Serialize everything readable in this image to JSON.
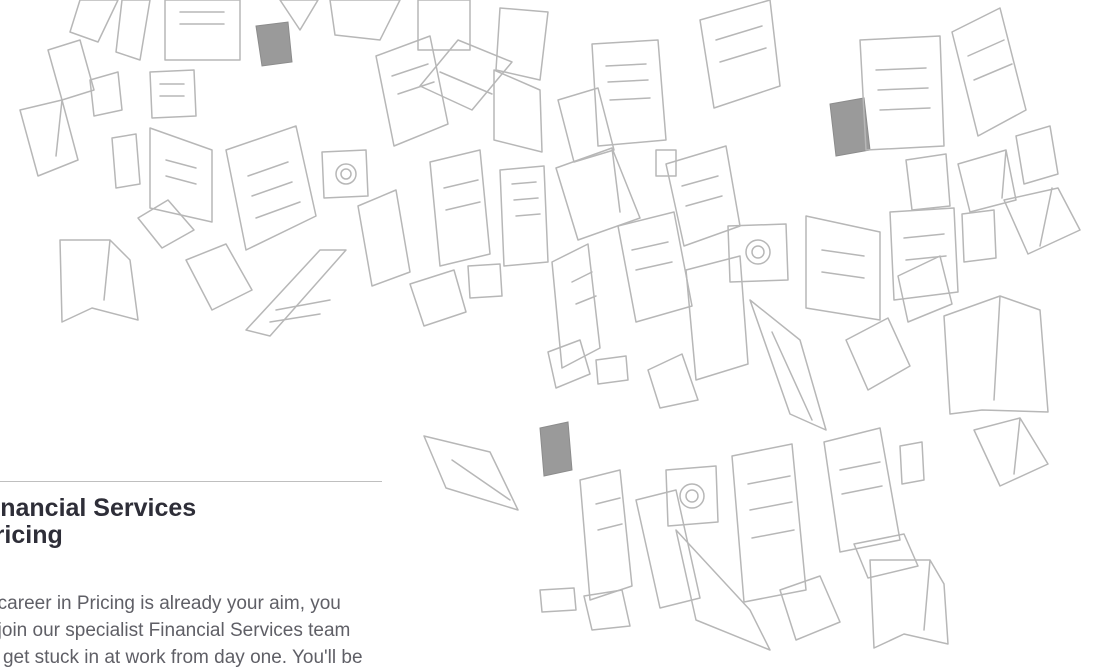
{
  "illustration": {
    "name": "hand-drawn-books-cluster"
  },
  "section": {
    "heading_lines": [
      "Financial Services",
      "Pricing"
    ],
    "body_lines": [
      "If a career in Pricing is already your aim, you",
      "will join our specialist Financial Services team",
      "and get stuck in at work from day one. You'll be"
    ]
  },
  "colors": {
    "heading": "#2e2e38",
    "body": "#5f5f66",
    "sketch": "#b7b7b7",
    "rule": "#bfbfbf"
  }
}
